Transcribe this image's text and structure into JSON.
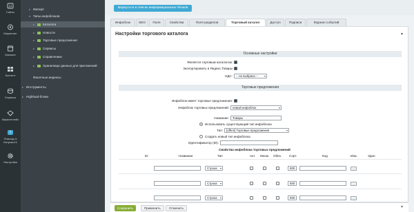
{
  "rail": [
    {
      "label": "Сайты",
      "icon": "sites-icon"
    },
    {
      "label": "Маркетинг",
      "icon": "marketing-icon"
    },
    {
      "label": "Магазин",
      "icon": "store-icon"
    },
    {
      "label": "Контент",
      "icon": "content-icon"
    },
    {
      "label": "Сервисы",
      "icon": "services-icon"
    },
    {
      "label": "Маркетплейс",
      "icon": "marketplace-icon"
    },
    {
      "label": "Помощь в Битрикс24",
      "icon": "help-icon"
    },
    {
      "label": "Настройки",
      "icon": "settings-icon"
    }
  ],
  "tree": [
    {
      "label": "Импорт",
      "level": 1
    },
    {
      "label": "Типы инфоблоков",
      "level": 1
    },
    {
      "label": "Каталоги",
      "level": 2
    },
    {
      "label": "Новости",
      "level": 2
    },
    {
      "label": "Торговые предложения",
      "level": 2
    },
    {
      "label": "Сервисы",
      "level": 2
    },
    {
      "label": "Справочники",
      "level": 2
    },
    {
      "label": "Хранилище данных для приложений",
      "level": 2
    },
    {
      "label": "Фасетные индексы",
      "level": 1
    },
    {
      "label": "Инструменты",
      "level": 0
    },
    {
      "label": "Highload-блоки",
      "level": 0
    }
  ],
  "header": {
    "back_label": "Вернуться в список информационных блоков"
  },
  "tabs": [
    "Инфоблок",
    "SEO",
    "Поля",
    "Свойства",
    "Поля разделов",
    "Торговый каталог",
    "Доступ",
    "Подписи",
    "Журнал событий"
  ],
  "content": {
    "title": "Настройки торгового каталога",
    "section_main": "Основные настройки",
    "is_catalog_label": "Является торговым каталогом:",
    "export_yandex_label": "Экспортировать в Яндекс.Товары",
    "vat_label": "НДС:",
    "vat_value": "-- не выбрано --",
    "section_offers": "Торговые предложения",
    "has_offers_label": "Инфоблок имеет торговые предложения:",
    "offers_iblock_label": "Инфоблок торговых предложений:",
    "offers_iblock_value": "новый инфоблок",
    "name_label": "Название:",
    "name_value": "Товары",
    "use_existing_label": "Использовать существующий тип инфоблока",
    "type_label": "Тип:",
    "type_value": "[offers] Торговые предложения",
    "create_new_label": "Создать новый тип инфоблока",
    "identifier_label": "Идентификатор (ID):",
    "props_title": "Свойства инфоблока торговых предложений",
    "columns": [
      "ID",
      "Название",
      "Тип",
      "Акт.",
      "Множ.",
      "Обяз.",
      "Сорт.",
      "Код",
      "Изм.",
      "Удал."
    ],
    "rows": [
      {
        "type": "Строка",
        "sort": "500",
        "edit": "..."
      },
      {
        "type": "Строка",
        "sort": "500",
        "edit": "..."
      },
      {
        "type": "Строка",
        "sort": "500",
        "edit": "..."
      }
    ]
  },
  "footer": {
    "save": "Сохранить",
    "apply": "Применить",
    "cancel": "Отменить"
  },
  "colors": {
    "accent": "#3fa9d4",
    "save": "#86ad36",
    "rail": "#2b3236"
  }
}
